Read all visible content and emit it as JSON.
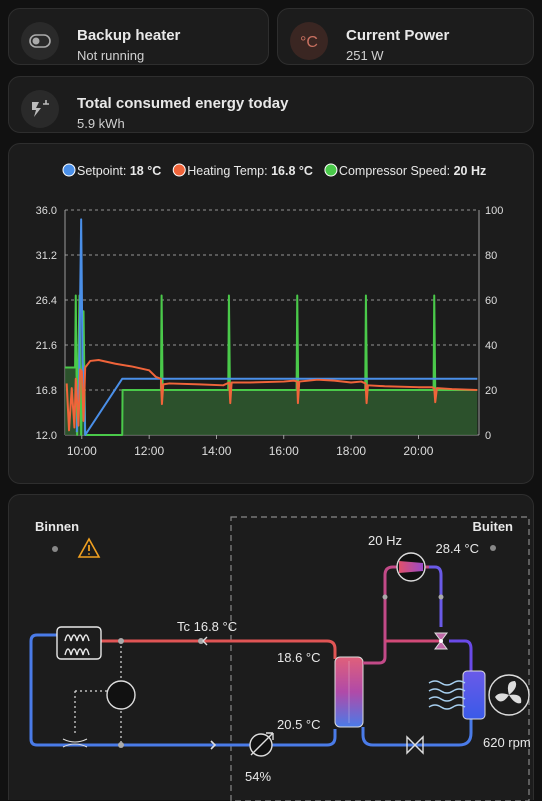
{
  "tiles": {
    "backup_heater": {
      "title": "Backup heater",
      "state": "Not running"
    },
    "current_power": {
      "title": "Current Power",
      "state": "251 W"
    },
    "energy_today": {
      "title": "Total consumed energy today",
      "state": "5.9 kWh"
    }
  },
  "chart_data": {
    "type": "line",
    "legend": [
      {
        "name": "Setpoint:",
        "value": "18 °C",
        "color": "#4a8fe8"
      },
      {
        "name": "Heating Temp:",
        "value": "16.8 °C",
        "color": "#f0643a"
      },
      {
        "name": "Compressor Speed:",
        "value": "20 Hz",
        "color": "#4ac94a"
      }
    ],
    "y_left_ticks": [
      "36.0",
      "31.2",
      "26.4",
      "21.6",
      "16.8",
      "12.0"
    ],
    "y_right_ticks": [
      "100",
      "80",
      "60",
      "40",
      "20",
      "0"
    ],
    "x_ticks": [
      "10:00",
      "12:00",
      "14:00",
      "16:00",
      "18:00",
      "20:00"
    ],
    "ylim_left": [
      12.0,
      36.0
    ],
    "ylim_right": [
      0,
      100
    ],
    "xlim_hours": [
      9.5,
      21.8
    ],
    "series": [
      {
        "name": "Setpoint",
        "axis": "left",
        "color": "#4a8fe8",
        "points": [
          [
            9.85,
            12.3
          ],
          [
            9.92,
            18.0
          ],
          [
            9.98,
            35.0
          ],
          [
            10.02,
            20.0
          ],
          [
            10.06,
            18.0
          ],
          [
            10.1,
            12.0
          ],
          [
            11.2,
            18.0
          ],
          [
            21.75,
            18.0
          ]
        ]
      },
      {
        "name": "Heating Temp",
        "axis": "left",
        "color": "#f0643a",
        "points": [
          [
            9.55,
            17.5
          ],
          [
            9.62,
            12.5
          ],
          [
            9.7,
            17.0
          ],
          [
            9.78,
            12.8
          ],
          [
            9.82,
            18.0
          ],
          [
            9.9,
            13.0
          ],
          [
            9.95,
            19.0
          ],
          [
            10.0,
            18.8
          ],
          [
            10.05,
            13.5
          ],
          [
            10.1,
            19.2
          ],
          [
            10.25,
            19.9
          ],
          [
            10.5,
            20.0
          ],
          [
            11.0,
            19.6
          ],
          [
            11.5,
            19.3
          ],
          [
            12.0,
            18.9
          ],
          [
            12.2,
            18.2
          ],
          [
            12.35,
            18.0
          ],
          [
            12.38,
            15.3
          ],
          [
            12.42,
            17.4
          ],
          [
            12.6,
            17.5
          ],
          [
            13.5,
            17.4
          ],
          [
            14.2,
            17.3
          ],
          [
            14.38,
            17.6
          ],
          [
            14.41,
            15.4
          ],
          [
            14.45,
            17.6
          ],
          [
            15.0,
            17.6
          ],
          [
            16.0,
            17.7
          ],
          [
            16.3,
            17.8
          ],
          [
            16.4,
            17.7
          ],
          [
            16.42,
            15.4
          ],
          [
            16.46,
            17.7
          ],
          [
            17.0,
            17.9
          ],
          [
            17.5,
            17.8
          ],
          [
            18.0,
            17.6
          ],
          [
            18.3,
            17.7
          ],
          [
            18.43,
            17.5
          ],
          [
            18.46,
            15.4
          ],
          [
            18.5,
            17.3
          ],
          [
            19.0,
            17.2
          ],
          [
            20.0,
            17.1
          ],
          [
            20.4,
            17.1
          ],
          [
            20.47,
            17.0
          ],
          [
            20.5,
            15.5
          ],
          [
            20.55,
            17.0
          ],
          [
            21.0,
            16.9
          ],
          [
            21.75,
            16.8
          ]
        ]
      },
      {
        "name": "Compressor Speed",
        "axis": "right",
        "color": "#4ac94a",
        "fill": true,
        "points": [
          [
            9.5,
            30
          ],
          [
            9.8,
            30
          ],
          [
            9.82,
            62
          ],
          [
            9.86,
            0
          ],
          [
            9.93,
            62
          ],
          [
            9.98,
            0
          ],
          [
            10.05,
            55
          ],
          [
            10.1,
            0
          ],
          [
            11.2,
            0
          ],
          [
            11.21,
            20
          ],
          [
            12.35,
            20
          ],
          [
            12.37,
            62
          ],
          [
            12.4,
            20
          ],
          [
            14.35,
            20
          ],
          [
            14.37,
            62
          ],
          [
            14.4,
            20
          ],
          [
            16.38,
            20
          ],
          [
            16.4,
            62
          ],
          [
            16.43,
            20
          ],
          [
            18.42,
            20
          ],
          [
            18.44,
            62
          ],
          [
            18.47,
            20
          ],
          [
            20.45,
            20
          ],
          [
            20.47,
            62
          ],
          [
            20.5,
            20
          ],
          [
            21.75,
            20
          ]
        ]
      }
    ]
  },
  "diagram": {
    "binnen_label": "Binnen",
    "buiten_label": "Buiten",
    "compressor_freq": "20 Hz",
    "outside_temp": "28.4 °C",
    "tc_label": "Tc 16.8 °C",
    "flow_temp": "18.6 °C",
    "return_temp": "20.5 °C",
    "valve_pct": "54%",
    "fan_rpm": "620 rpm",
    "warning_icon": "warning-icon",
    "colors": {
      "hot": "#e05555",
      "cold": "#4a7be8",
      "mid": "#b04a9a"
    }
  }
}
